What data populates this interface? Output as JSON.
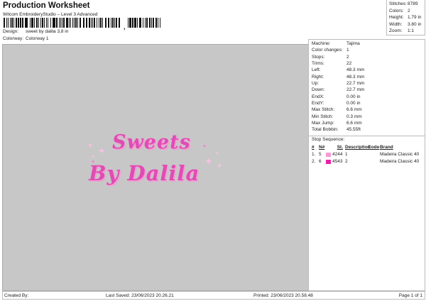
{
  "header": {
    "title": "Production Worksheet",
    "subtitle": "Wilcom EmbroideryStudio – Level 3 Advanced",
    "barcode_separator": ",",
    "design_label": "Design:",
    "design_value": "sweet by dalila 3,8 in",
    "colorway_label": "Colorway:",
    "colorway_value": "Colorway 1"
  },
  "summary": [
    {
      "label": "Stitches:",
      "value": "8789"
    },
    {
      "label": "Colors:",
      "value": "2"
    },
    {
      "label": "Height:",
      "value": "1.79 in"
    },
    {
      "label": "Width:",
      "value": "3.80 in"
    },
    {
      "label": "Zoom:",
      "value": "1:1"
    }
  ],
  "stats": [
    {
      "label": "Machine:",
      "value": "Tajima"
    },
    {
      "label": "Color changes:",
      "value": "1"
    },
    {
      "label": "Stops:",
      "value": "2"
    },
    {
      "label": "Trims:",
      "value": "22"
    },
    {
      "label": "Left:",
      "value": "48.3 mm"
    },
    {
      "label": "Right:",
      "value": "48.3 mm"
    },
    {
      "label": "Up:",
      "value": "22.7 mm"
    },
    {
      "label": "Down:",
      "value": "22.7 mm"
    },
    {
      "label": "EndX:",
      "value": "0.00 in"
    },
    {
      "label": "EndY:",
      "value": "0.00 in"
    },
    {
      "label": "Max Stitch:",
      "value": "6.6 mm"
    },
    {
      "label": "Min Stitch:",
      "value": "0.3 mm"
    },
    {
      "label": "Max Jump:",
      "value": "6.6 mm"
    },
    {
      "label": "Total Bobbin:",
      "value": "45.55ft"
    }
  ],
  "stop_sequence": {
    "title": "Stop Sequence:",
    "columns": [
      "#",
      "N#",
      "St.",
      "Description",
      "Code",
      "Brand"
    ],
    "rows": [
      {
        "num": "1.",
        "n": "5",
        "color": "#f59ad0",
        "st": "4244",
        "desc": "1",
        "code": "",
        "brand": "Madeira Classic 40"
      },
      {
        "num": "2.",
        "n": "6",
        "color": "#ec1fa6",
        "st": "4543",
        "desc": "2",
        "code": "",
        "brand": "Madeira Classic 40"
      }
    ]
  },
  "design_art": {
    "line1": "Sweets",
    "line2": "By Dalila"
  },
  "footer": {
    "created_by": "Created By:",
    "last_saved": "Last Saved: 23/06/2023 20.26.21",
    "printed": "Printed: 23/06/2023 20.58.48",
    "page": "Page 1 of 1"
  }
}
